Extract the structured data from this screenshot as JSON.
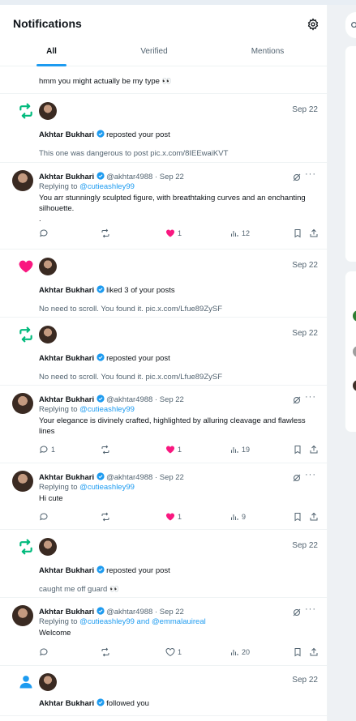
{
  "header": {
    "title": "Notifications",
    "tabs": [
      {
        "label": "All"
      },
      {
        "label": "Verified"
      },
      {
        "label": "Mentions"
      }
    ]
  },
  "feed": {
    "partial_text": "hmm you might actually be my type 👀",
    "items": [
      {
        "type": "repost",
        "date": "Sep 22",
        "name": "Akhtar Bukhari",
        "action": "reposted your post",
        "text": "This one was dangerous to post pic.x.com/8IEEwaiKVT"
      },
      {
        "type": "reply",
        "name": "Akhtar Bukhari",
        "handle": "@akhtar4988 · Sep 22",
        "replying_label": "Replying to",
        "replying_to": "@cutieashley99",
        "text": "You arr stunningly sculpted figure, with breathtaking curves and an enchanting silhouette.\n.",
        "likes": "1",
        "views": "12"
      },
      {
        "type": "like",
        "date": "Sep 22",
        "name": "Akhtar Bukhari",
        "action": "liked 3 of your posts",
        "text": "No need to scroll. You found it. pic.x.com/Lfue89ZySF"
      },
      {
        "type": "repost",
        "date": "Sep 22",
        "name": "Akhtar Bukhari",
        "action": "reposted your post",
        "text": "No need to scroll. You found it. pic.x.com/Lfue89ZySF"
      },
      {
        "type": "reply",
        "name": "Akhtar Bukhari",
        "handle": "@akhtar4988 · Sep 22",
        "replying_label": "Replying to",
        "replying_to": "@cutieashley99",
        "text": "Your elegance is divinely crafted, highlighted by alluring cleavage and flawless lines",
        "replies": "1",
        "likes": "1",
        "views": "19"
      },
      {
        "type": "reply",
        "name": "Akhtar Bukhari",
        "handle": "@akhtar4988 · Sep 22",
        "replying_label": "Replying to",
        "replying_to": "@cutieashley99",
        "text": "Hi cute",
        "likes": "1",
        "views": "9"
      },
      {
        "type": "repost",
        "date": "Sep 22",
        "name": "Akhtar Bukhari",
        "action": "reposted your post",
        "text": "caught me off guard 👀"
      },
      {
        "type": "reply",
        "name": "Akhtar Bukhari",
        "handle": "@akhtar4988 · Sep 22",
        "replying_label": "Replying to",
        "replying_to": "@cutieashley99 and @emmalauireal",
        "text": "Welcome",
        "likes": "1",
        "views": "20"
      },
      {
        "type": "follow",
        "date": "Sep 22",
        "name": "Akhtar Bukhari",
        "action": "followed you"
      }
    ]
  },
  "colors": {
    "accent": "#1d9bf0",
    "repost": "#00ba7c",
    "like": "#f91880",
    "text": "#0f1419",
    "muted": "#536471"
  }
}
